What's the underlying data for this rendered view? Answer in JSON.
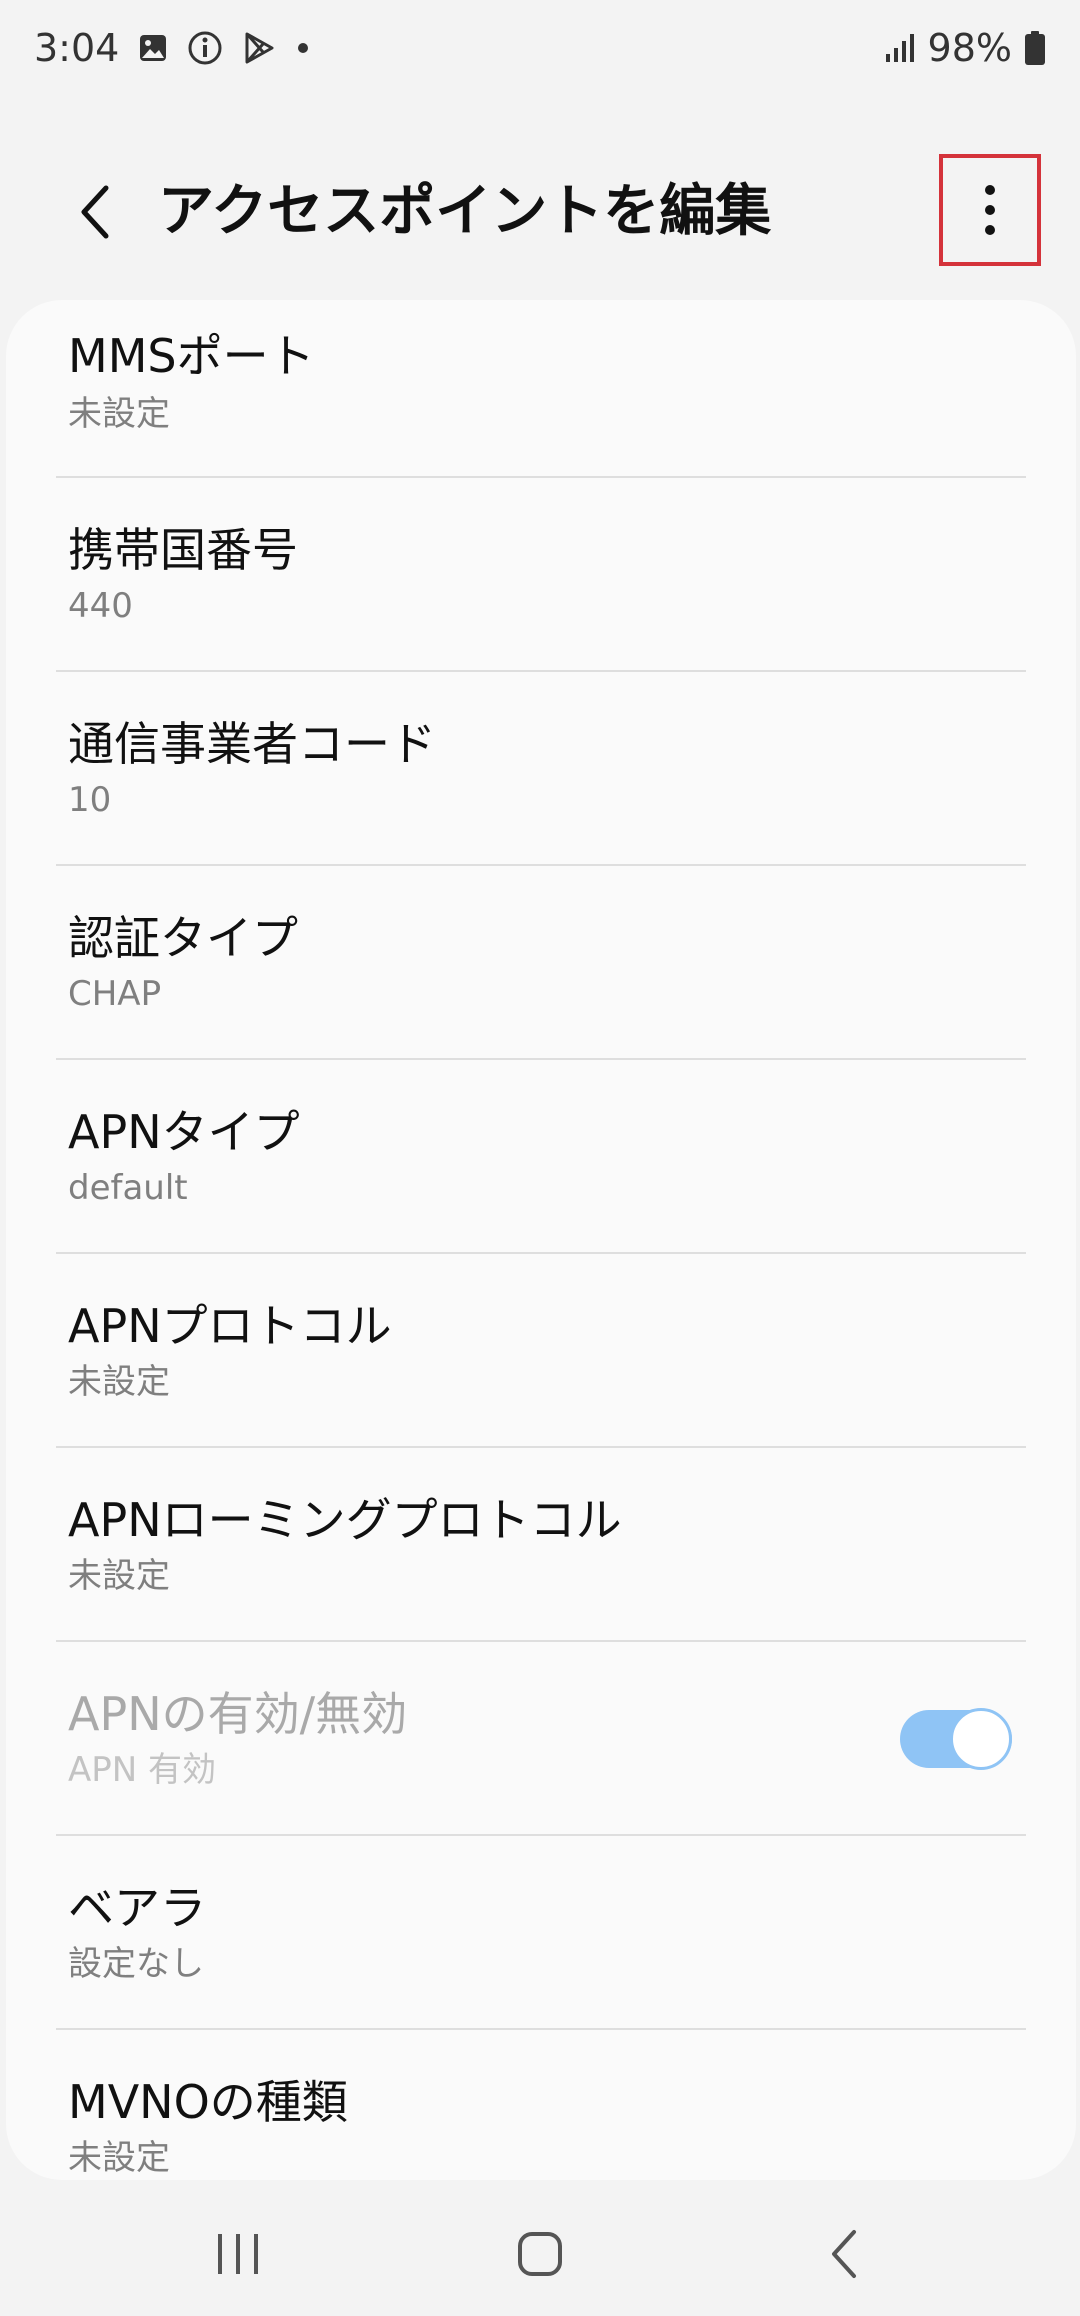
{
  "status_bar": {
    "time": "3:04",
    "battery": "98%",
    "icons": [
      "gallery-icon",
      "info-icon",
      "play-store-icon",
      "dot-icon",
      "signal-icon",
      "battery-icon"
    ]
  },
  "header": {
    "title": "アクセスポイントを編集",
    "back_icon": "chevron-left-icon",
    "more_icon": "more-vert-icon",
    "highlight_color": "#d4323a"
  },
  "settings": [
    {
      "title": "MMSポート",
      "value": "未設定"
    },
    {
      "title": "携帯国番号",
      "value": "440"
    },
    {
      "title": "通信事業者コード",
      "value": "10"
    },
    {
      "title": "認証タイプ",
      "value": "CHAP"
    },
    {
      "title": "APNタイプ",
      "value": "default"
    },
    {
      "title": "APNプロトコル",
      "value": "未設定"
    },
    {
      "title": "APNローミングプロトコル",
      "value": "未設定"
    },
    {
      "title": "APNの有効/無効",
      "value": "APN 有効",
      "toggle": true,
      "toggle_on": true,
      "disabled": true
    },
    {
      "title": "ベアラ",
      "value": "設定なし"
    },
    {
      "title": "MVNOの種類",
      "value": "未設定"
    }
  ],
  "nav_bar": {
    "recents_icon": "recents-icon",
    "home_icon": "home-icon",
    "back_icon": "nav-back-icon"
  },
  "colors": {
    "accent": "#8fc4f5",
    "background": "#f3f3f3",
    "card": "#fafafa"
  }
}
